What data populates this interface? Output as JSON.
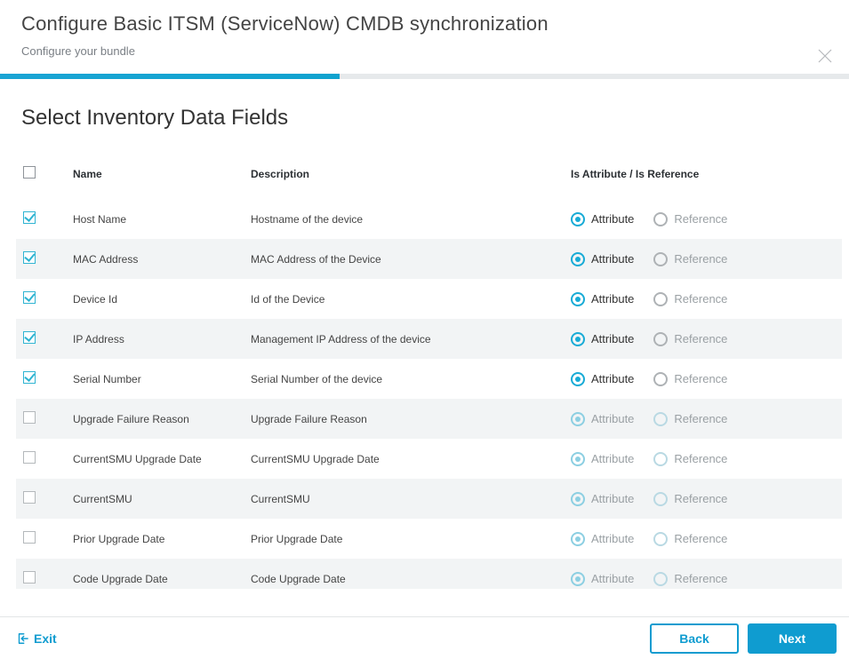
{
  "header": {
    "title": "Configure Basic ITSM (ServiceNow) CMDB synchronization",
    "subtitle": "Configure your bundle"
  },
  "section": {
    "title": "Select Inventory Data Fields"
  },
  "table": {
    "columns": {
      "name": "Name",
      "description": "Description",
      "attr_ref": "Is Attribute / Is Reference"
    },
    "radio_labels": {
      "attribute": "Attribute",
      "reference": "Reference"
    },
    "rows": [
      {
        "checked": true,
        "enabled": true,
        "name": "Host Name",
        "description": "Hostname of the device",
        "value": "attribute"
      },
      {
        "checked": true,
        "enabled": true,
        "name": "MAC Address",
        "description": "MAC Address of the Device",
        "value": "attribute"
      },
      {
        "checked": true,
        "enabled": true,
        "name": "Device Id",
        "description": "Id of the Device",
        "value": "attribute"
      },
      {
        "checked": true,
        "enabled": true,
        "name": "IP Address",
        "description": "Management IP Address of the device",
        "value": "attribute"
      },
      {
        "checked": true,
        "enabled": true,
        "name": "Serial Number",
        "description": "Serial Number of the device",
        "value": "attribute"
      },
      {
        "checked": false,
        "enabled": false,
        "name": "Upgrade Failure Reason",
        "description": "Upgrade Failure Reason",
        "value": "attribute"
      },
      {
        "checked": false,
        "enabled": false,
        "name": "CurrentSMU Upgrade Date",
        "description": "CurrentSMU Upgrade Date",
        "value": "attribute"
      },
      {
        "checked": false,
        "enabled": false,
        "name": "CurrentSMU",
        "description": "CurrentSMU",
        "value": "attribute"
      },
      {
        "checked": false,
        "enabled": false,
        "name": "Prior Upgrade Date",
        "description": "Prior Upgrade Date",
        "value": "attribute"
      },
      {
        "checked": false,
        "enabled": false,
        "name": "Code Upgrade Date",
        "description": "Code Upgrade Date",
        "value": "attribute"
      }
    ]
  },
  "footer": {
    "exit": "Exit",
    "back": "Back",
    "next": "Next"
  }
}
